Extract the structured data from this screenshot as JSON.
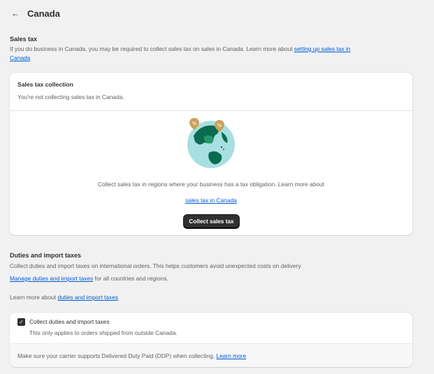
{
  "header": {
    "title": "Canada",
    "back_icon": "arrow-left-icon"
  },
  "sales_tax": {
    "title": "Sales tax",
    "desc_line1_prefix": "If you do business in Canada, you may be required to collect sales tax on sales in Canada. Learn more about ",
    "desc_link_part1": "setting up sales tax in",
    "desc_link_part2": "Canada",
    "card": {
      "title": "Sales tax collection",
      "subtitle": "You're not collecting sales tax in Canada.",
      "illustration_icon": "globe-tax-icon",
      "empty_text": "Collect sales tax in regions where your business has a tax obligation. Learn more about",
      "empty_link": "sales tax in Canada",
      "button_label": "Collect sales tax"
    }
  },
  "duties": {
    "title": "Duties and import taxes",
    "desc": "Collect duties and import taxes on international orders. This helps customers avoid unexpected costs on delivery.",
    "manage_link": "Manage duties and import taxes",
    "manage_suffix": " for all countries and regions.",
    "learn_prefix": "Learn more about ",
    "learn_link": "duties and import taxes",
    "card": {
      "checkbox_checked": true,
      "checkbox_label": "Collect duties and import taxes",
      "checkbox_help": "This only applies to orders shipped from outside Canada.",
      "footer_text": "Make sure your carrier supports Delivered Duty Paid (DDP) when collecting. ",
      "footer_link": "Learn more"
    }
  },
  "colors": {
    "accent_link": "#005bd3",
    "primary_button": "#303030",
    "background": "#f1f1f1"
  }
}
